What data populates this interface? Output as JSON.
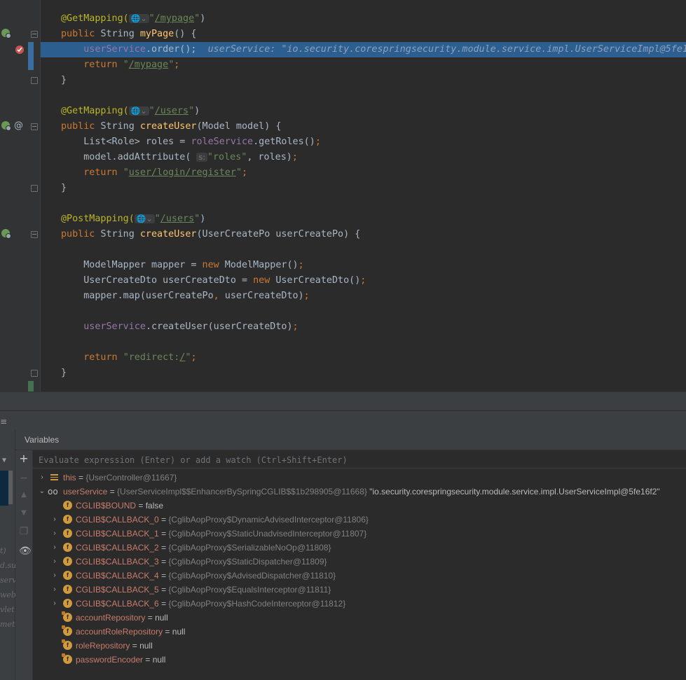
{
  "editor": {
    "lines": [
      {
        "id": "l1",
        "parts": [
          [
            "ann",
            "@GetMapping("
          ],
          [
            "inlay",
            "🌐⌄"
          ],
          [
            "str",
            "\""
          ],
          [
            "str u",
            "/mypage"
          ],
          [
            "str",
            "\""
          ],
          [
            "plain",
            ")"
          ]
        ]
      },
      {
        "id": "l2",
        "parts": [
          [
            "kw",
            "public "
          ],
          [
            "plain",
            "String "
          ],
          [
            "fn",
            "myPage"
          ],
          [
            "plain",
            "() {"
          ]
        ]
      },
      {
        "id": "l3",
        "parts": [
          [
            "plain",
            "    "
          ],
          [
            "fld",
            "userService"
          ],
          [
            "plain",
            ".order();  "
          ],
          [
            "hint",
            "userService: \"io.security.corespringsecurity.module.service.impl.UserServiceImpl@5fe1"
          ]
        ]
      },
      {
        "id": "l4",
        "parts": [
          [
            "plain",
            "    "
          ],
          [
            "kw",
            "return "
          ],
          [
            "str",
            "\""
          ],
          [
            "str u",
            "/mypage"
          ],
          [
            "str",
            "\""
          ],
          [
            "kw",
            ";"
          ]
        ]
      },
      {
        "id": "l5",
        "parts": [
          [
            "plain",
            "}"
          ]
        ]
      },
      {
        "id": "l6",
        "parts": []
      },
      {
        "id": "l7",
        "parts": [
          [
            "ann",
            "@GetMapping("
          ],
          [
            "inlay",
            "🌐⌄"
          ],
          [
            "str",
            "\""
          ],
          [
            "str u",
            "/users"
          ],
          [
            "str",
            "\""
          ],
          [
            "plain",
            ")"
          ]
        ]
      },
      {
        "id": "l8",
        "parts": [
          [
            "kw",
            "public "
          ],
          [
            "plain",
            "String "
          ],
          [
            "fn",
            "createUser"
          ],
          [
            "plain",
            "(Model model) {"
          ]
        ]
      },
      {
        "id": "l9",
        "parts": [
          [
            "plain",
            "    List<Role> roles = "
          ],
          [
            "fld",
            "roleService"
          ],
          [
            "plain",
            ".getRoles()"
          ],
          [
            "kw",
            ";"
          ]
        ]
      },
      {
        "id": "l10",
        "parts": [
          [
            "plain",
            "    model.addAttribute( "
          ],
          [
            "inlay",
            "s:"
          ],
          [
            "str",
            "\"roles\""
          ],
          [
            "plain",
            ", roles)"
          ],
          [
            "kw",
            ";"
          ]
        ]
      },
      {
        "id": "l11",
        "parts": [
          [
            "plain",
            "    "
          ],
          [
            "kw",
            "return "
          ],
          [
            "str",
            "\""
          ],
          [
            "str u",
            "user/login/register"
          ],
          [
            "str",
            "\""
          ],
          [
            "kw",
            ";"
          ]
        ]
      },
      {
        "id": "l12",
        "parts": [
          [
            "plain",
            "}"
          ]
        ]
      },
      {
        "id": "l13",
        "parts": []
      },
      {
        "id": "l14",
        "parts": [
          [
            "ann",
            "@PostMapping("
          ],
          [
            "inlay",
            "🌐⌄"
          ],
          [
            "str",
            "\""
          ],
          [
            "str u",
            "/users"
          ],
          [
            "str",
            "\""
          ],
          [
            "plain",
            ")"
          ]
        ]
      },
      {
        "id": "l15",
        "parts": [
          [
            "kw",
            "public "
          ],
          [
            "plain",
            "String "
          ],
          [
            "fn",
            "createUser"
          ],
          [
            "plain",
            "(UserCreatePo userCreatePo) {"
          ]
        ]
      },
      {
        "id": "l16",
        "parts": []
      },
      {
        "id": "l17",
        "parts": [
          [
            "plain",
            "    ModelMapper mapper = "
          ],
          [
            "kw",
            "new "
          ],
          [
            "plain",
            "ModelMapper()"
          ],
          [
            "kw",
            ";"
          ]
        ]
      },
      {
        "id": "l18",
        "parts": [
          [
            "plain",
            "    UserCreateDto userCreateDto = "
          ],
          [
            "kw",
            "new "
          ],
          [
            "plain",
            "UserCreateDto()"
          ],
          [
            "kw",
            ";"
          ]
        ]
      },
      {
        "id": "l19",
        "parts": [
          [
            "plain",
            "    mapper.map(userCreatePo"
          ],
          [
            "kw",
            ", "
          ],
          [
            "plain",
            "userCreateDto)"
          ],
          [
            "kw",
            ";"
          ]
        ]
      },
      {
        "id": "l20",
        "parts": []
      },
      {
        "id": "l21",
        "parts": [
          [
            "plain",
            "    "
          ],
          [
            "fld",
            "userService"
          ],
          [
            "plain",
            ".createUser(userCreateDto)"
          ],
          [
            "kw",
            ";"
          ]
        ]
      },
      {
        "id": "l22",
        "parts": []
      },
      {
        "id": "l23",
        "parts": [
          [
            "plain",
            "    "
          ],
          [
            "kw",
            "return "
          ],
          [
            "str",
            "\"redirect:"
          ],
          [
            "str u",
            "/"
          ],
          [
            "str",
            "\""
          ],
          [
            "kw",
            ";"
          ]
        ]
      },
      {
        "id": "l24",
        "parts": [
          [
            "plain",
            "}"
          ]
        ]
      }
    ]
  },
  "debug": {
    "panel_title": "Variables",
    "eval_placeholder": "Evaluate expression (Enter) or add a watch (Ctrl+Shift+Enter)",
    "left_cut_texts": [
      "t)",
      "d.su",
      "serv",
      "web",
      "vlet.",
      "meth"
    ],
    "vars": [
      {
        "arrow": "›",
        "icon": "list",
        "name": "this",
        "value": "{UserController@11667}",
        "str": ""
      },
      {
        "arrow": "⌄",
        "icon": "watch",
        "name": "userService",
        "value": "{UserServiceImpl$$EnhancerBySpringCGLIB$$1b298905@11668}",
        "str": "\"io.security.corespringsecurity.module.service.impl.UserServiceImpl@5fe16f2\""
      },
      {
        "arrow": "",
        "icon": "f",
        "name": "CGLIB$BOUND",
        "value": "false",
        "str": ""
      },
      {
        "arrow": "›",
        "icon": "f",
        "name": "CGLIB$CALLBACK_0",
        "value": "{CglibAopProxy$DynamicAdvisedInterceptor@11806}",
        "str": ""
      },
      {
        "arrow": "›",
        "icon": "f",
        "name": "CGLIB$CALLBACK_1",
        "value": "{CglibAopProxy$StaticUnadvisedInterceptor@11807}",
        "str": ""
      },
      {
        "arrow": "›",
        "icon": "f",
        "name": "CGLIB$CALLBACK_2",
        "value": "{CglibAopProxy$SerializableNoOp@11808}",
        "str": ""
      },
      {
        "arrow": "›",
        "icon": "f",
        "name": "CGLIB$CALLBACK_3",
        "value": "{CglibAopProxy$StaticDispatcher@11809}",
        "str": ""
      },
      {
        "arrow": "›",
        "icon": "f",
        "name": "CGLIB$CALLBACK_4",
        "value": "{CglibAopProxy$AdvisedDispatcher@11810}",
        "str": ""
      },
      {
        "arrow": "›",
        "icon": "f",
        "name": "CGLIB$CALLBACK_5",
        "value": "{CglibAopProxy$EqualsInterceptor@11811}",
        "str": ""
      },
      {
        "arrow": "›",
        "icon": "f",
        "name": "CGLIB$CALLBACK_6",
        "value": "{CglibAopProxy$HashCodeInterceptor@11812}",
        "str": ""
      },
      {
        "arrow": "",
        "icon": "flock",
        "name": "accountRepository",
        "value": "null",
        "str": ""
      },
      {
        "arrow": "",
        "icon": "flock",
        "name": "accountRoleRepository",
        "value": "null",
        "str": ""
      },
      {
        "arrow": "",
        "icon": "flock",
        "name": "roleRepository",
        "value": "null",
        "str": ""
      },
      {
        "arrow": "",
        "icon": "flock",
        "name": "passwordEncoder",
        "value": "null",
        "str": ""
      }
    ],
    "value_prefix": " = ",
    "field_icon_letter": "f",
    "colors": {
      "accent_selection": "#2d5e90",
      "field_icon": "#d19a3c",
      "var_name": "#c77c6b"
    }
  }
}
